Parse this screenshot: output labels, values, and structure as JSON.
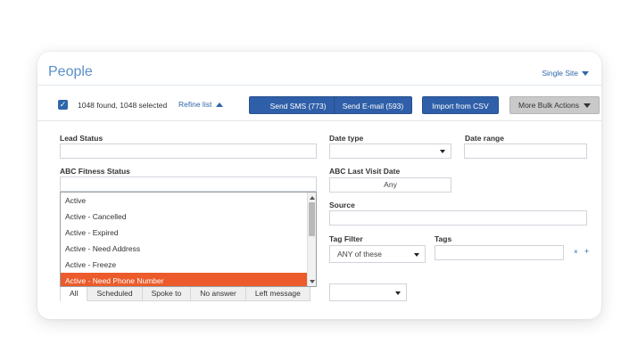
{
  "header": {
    "title": "People",
    "site_select": "Single Site"
  },
  "toolbar": {
    "found_text": "1048 found, 1048 selected",
    "refine_label": "Refine list",
    "send_sms": "Send SMS (773)",
    "send_email": "Send E-mail (593)",
    "import_csv": "Import from CSV",
    "more_actions": "More Bulk Actions"
  },
  "filters": {
    "lead_status_label": "Lead Status",
    "date_type_label": "Date type",
    "date_range_label": "Date range",
    "abc_fitness_status_label": "ABC Fitness Status",
    "abc_last_visit_label": "ABC Last Visit Date",
    "abc_last_visit_value": "Any",
    "source_label": "Source",
    "tag_filter_label": "Tag Filter",
    "tag_filter_value": "ANY of these",
    "tags_label": "Tags",
    "tags_clear": "×",
    "tags_add": "+"
  },
  "status_options": [
    {
      "label": "Active",
      "selected": false
    },
    {
      "label": "Active - Cancelled",
      "selected": false
    },
    {
      "label": "Active - Expired",
      "selected": false
    },
    {
      "label": "Active - Need Address",
      "selected": false
    },
    {
      "label": "Active - Freeze",
      "selected": false
    },
    {
      "label": "Active - Need Phone Number",
      "selected": true
    }
  ],
  "tabs": [
    "All",
    "Scheduled",
    "Spoke to",
    "No answer",
    "Left message"
  ],
  "colors": {
    "primary": "#2f5fa8",
    "link": "#2f66ab",
    "title": "#5b8fc9",
    "selected_option": "#ec5b2b"
  }
}
